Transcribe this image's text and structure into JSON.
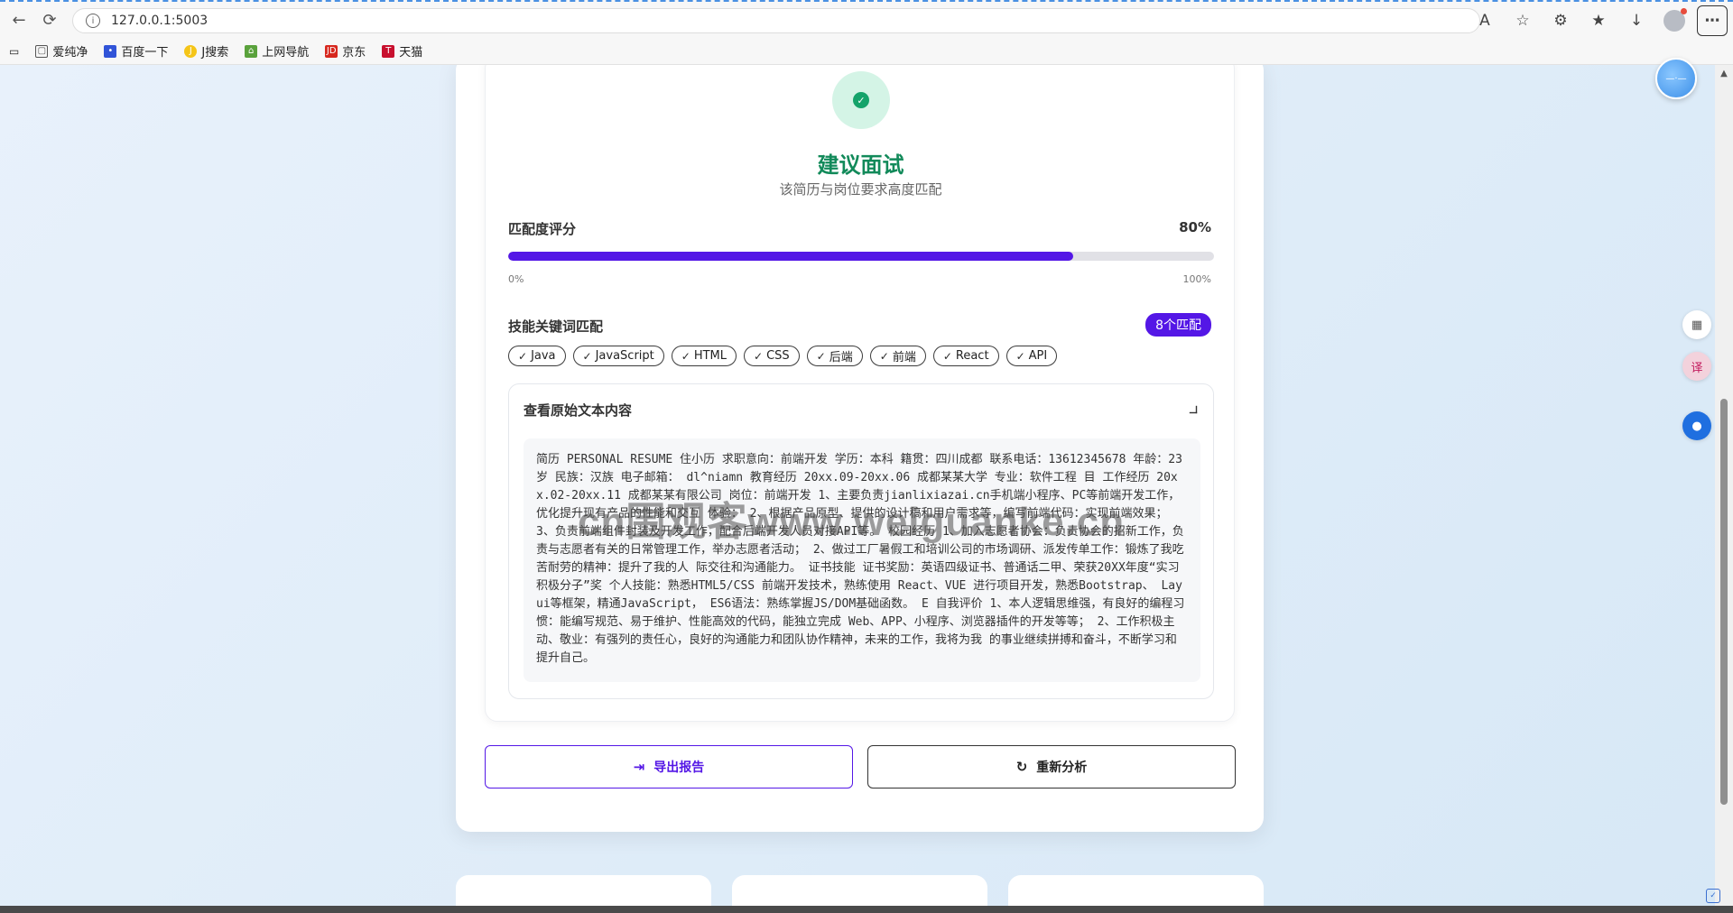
{
  "browser": {
    "url": "127.0.0.1:5003",
    "bookmarks": [
      "爱纯净",
      "百度一下",
      "J搜索",
      "上网导航",
      "京东",
      "天猫"
    ]
  },
  "result": {
    "verdict": "建议面试",
    "verdict_sub": "该简历与岗位要求高度匹配",
    "score_label": "匹配度评分",
    "score_value": "80%",
    "score_fraction": 0.8,
    "progress_min": "0%",
    "progress_max": "100%",
    "keywords_label": "技能关键词匹配",
    "keywords_badge": "8个匹配",
    "keywords": [
      "Java",
      "JavaScript",
      "HTML",
      "CSS",
      "后端",
      "前端",
      "React",
      "API"
    ],
    "raw_title": "查看原始文本内容",
    "raw_text": "简历 PERSONAL RESUME 住小历 求职意向：前端开发 学历：本科 籍贯：四川成都 联系电话：13612345678 年龄：23岁 民族：汉族 电子邮箱： dl^niamn 教育经历 20xx.09-20xx.06 成都某某大学 专业：软件工程 目 工作经历 20xx.02-20xx.11 成都某某有限公司 岗位：前端开发 1、主要负责jianlixiazai.cn手机端小程序、PC等前端开发工作，优化提升现有产品的性能和交互 体验： 2、根据产品原型、提供的设计稿和用户需求等，编写前端代码：实现前端效果； 3、负责前端组件封装及开发工作，配合后端开发人员对接API等。 校园经历 1、加入志愿者协会：负责协会的招新工作，负责与志愿者有关的日常管理工作，举办志愿者活动； 2、做过工厂暑假工和培训公司的市场调研、派发传单工作：锻炼了我吃苦耐劳的精神：提升了我的人 际交往和沟通能力。 证书技能 证书奖励：英语四级证书、普通话二甲、荣获20XX年度“实习积极分子”奖 个人技能：熟悉HTML5/CSS 前端开发技术，熟练使用 React、VUE 进行项目开发，熟悉Bootstrap、 Layui等框架，精通JavaScript， ES6语法：熟练掌握JS/DOM基础函数。 E 自我评价 1、本人逻辑思维强，有良好的编程习惯：能编写规范、易于维护、性能高效的代码，能独立完成 Web、APP、小程序、浏览器插件的开发等等； 2、工作积极主动、敬业：有强列的责任心，良好的沟通能力和团队协作精神，未来的工作，我将为我 的事业继续拼搏和奋斗，不断学习和提升自己。",
    "export_label": "导出报告",
    "reanalyze_label": "重新分析"
  },
  "watermark": "cn围观客www.weiguanke.cn",
  "colors": {
    "accent": "#5417e6",
    "success": "#128a5a"
  }
}
